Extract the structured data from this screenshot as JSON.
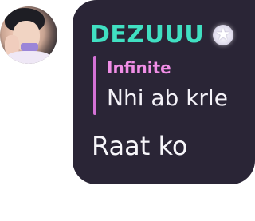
{
  "sender": {
    "name": "DEZUUU",
    "name_color": "#40e0c2",
    "avatar_icon": "profile-photo",
    "badge_icon": "star-icon"
  },
  "reply": {
    "author": "Infinite",
    "author_color": "#f08ee6",
    "text": "Nhi ab krle"
  },
  "message": {
    "text": "Raat ko"
  },
  "colors": {
    "bubble_bg": "#2a2536",
    "reply_bar": "#d472d6",
    "text": "#f4f2f8"
  }
}
